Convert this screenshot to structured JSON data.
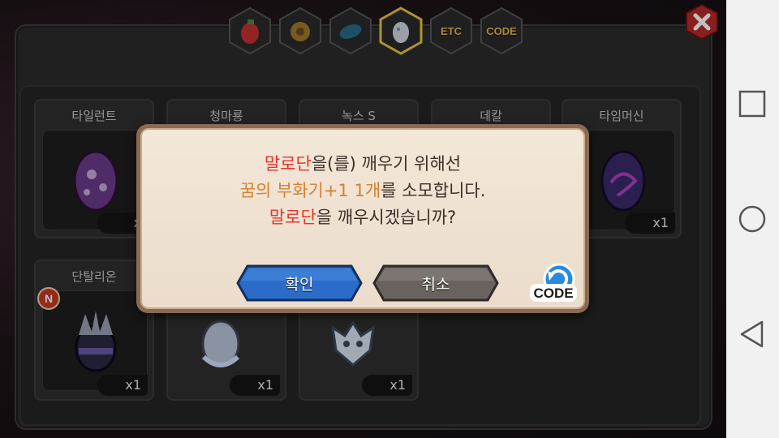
{
  "tabs": [
    {
      "name": "tab-fruit",
      "icon": "fruit-icon"
    },
    {
      "name": "tab-nut",
      "icon": "nut-icon"
    },
    {
      "name": "tab-leaf",
      "icon": "leaf-icon"
    },
    {
      "name": "tab-egg",
      "icon": "egg-icon",
      "active": true
    },
    {
      "name": "tab-etc",
      "label": "ETC"
    },
    {
      "name": "tab-code",
      "label": "CODE"
    }
  ],
  "slots": [
    {
      "name": "타일런트",
      "count": "x",
      "egg_color": "#6a3a8a"
    },
    {
      "name": "청마룡",
      "count": "",
      "egg_color": ""
    },
    {
      "name": "녹스 S",
      "count": "",
      "egg_color": ""
    },
    {
      "name": "데칼",
      "count": "",
      "egg_color": ""
    },
    {
      "name": "타임머신",
      "count": "x1",
      "egg_color": "#3a2a6a"
    },
    {
      "name": "단탈리온",
      "count": "x1",
      "badge": "N"
    },
    {
      "name": "",
      "count": "x1"
    },
    {
      "name": "",
      "count": "x1"
    }
  ],
  "dialog": {
    "line1_highlight": "말로단",
    "line1_rest": "을(를) 깨우기 위해선",
    "line2_highlight": "꿈의 부화기+1 1개",
    "line2_rest": "를 소모합니다.",
    "line3_highlight": "말로단",
    "line3_rest": "을 깨우시겠습니까?",
    "confirm_label": "확인",
    "cancel_label": "취소",
    "code_label": "CODE"
  },
  "colors": {
    "highlight_red": "#e8322a",
    "highlight_orange": "#d8802c",
    "confirm_blue": "#2a6cc8",
    "cancel_gray": "#6a625e"
  }
}
